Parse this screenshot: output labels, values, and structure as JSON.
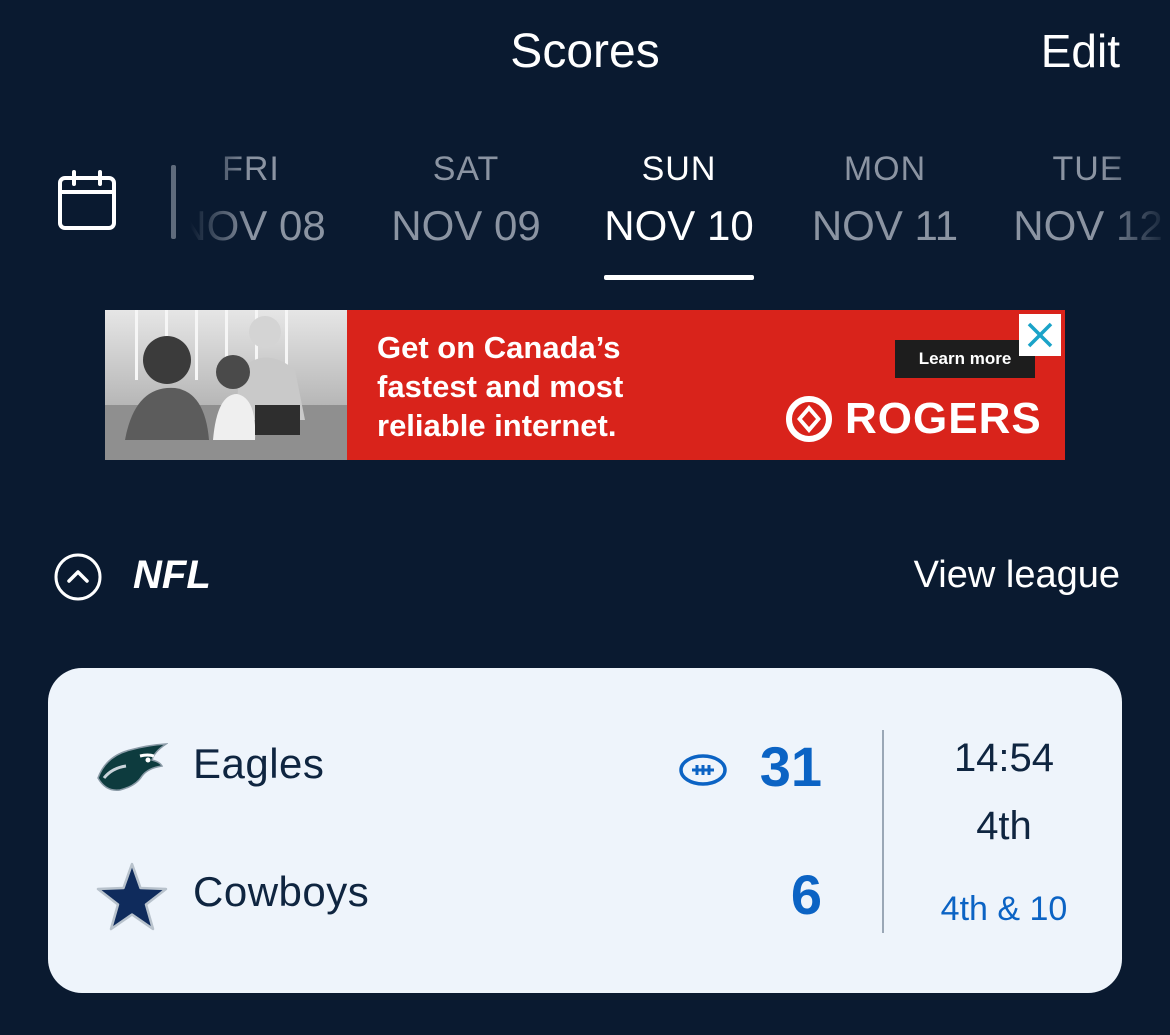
{
  "header": {
    "title": "Scores",
    "edit_label": "Edit"
  },
  "date_strip": {
    "items": [
      {
        "dow": "FRI",
        "date": "NOV 08",
        "selected": false
      },
      {
        "dow": "SAT",
        "date": "NOV 09",
        "selected": false
      },
      {
        "dow": "SUN",
        "date": "NOV 10",
        "selected": true
      },
      {
        "dow": "MON",
        "date": "NOV 11",
        "selected": false
      },
      {
        "dow": "TUE",
        "date": "NOV 12",
        "selected": false
      }
    ]
  },
  "ad": {
    "headline_line1": "Get on Canada’s",
    "headline_line2": "fastest and most",
    "headline_line3": "reliable internet.",
    "cta": "Learn more",
    "brand": "ROGERS"
  },
  "league": {
    "name": "NFL",
    "view_label": "View league"
  },
  "game": {
    "home": {
      "name": "Eagles",
      "score": "31",
      "has_possession": true
    },
    "away": {
      "name": "Cowboys",
      "score": "6",
      "has_possession": false
    },
    "clock": "14:54",
    "period": "4th",
    "down_distance": "4th & 10"
  },
  "colors": {
    "background": "#0a1a30",
    "card": "#eef4fb",
    "score_blue": "#0b63c4",
    "ad_red": "#d9231b"
  }
}
